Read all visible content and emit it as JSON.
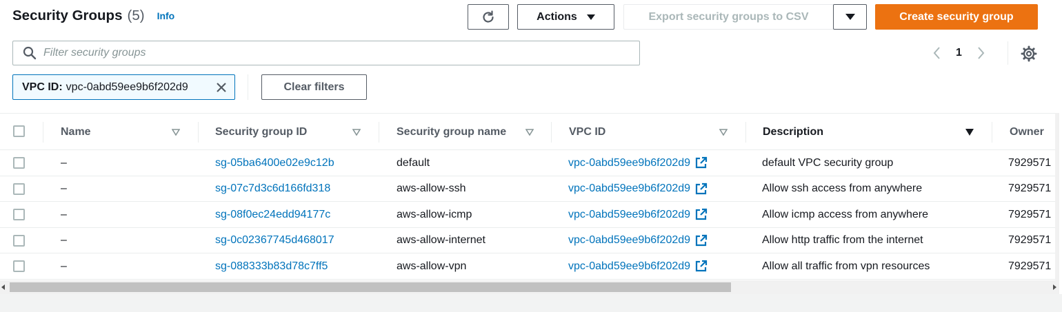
{
  "header": {
    "title": "Security Groups",
    "count": "(5)",
    "info": "Info"
  },
  "toolbar": {
    "refresh_icon": "refresh-icon",
    "actions_label": "Actions",
    "export_label": "Export security groups to CSV",
    "create_label": "Create security group"
  },
  "search": {
    "placeholder": "Filter security groups",
    "value": ""
  },
  "pagination": {
    "page": "1"
  },
  "filters": {
    "token_key": "VPC ID:",
    "token_value": "vpc-0abd59ee9b6f202d9",
    "clear_label": "Clear filters"
  },
  "table": {
    "columns": [
      "Name",
      "Security group ID",
      "Security group name",
      "VPC ID",
      "Description",
      "Owner"
    ],
    "rows": [
      {
        "name": "–",
        "sg_id": "sg-05ba6400e02e9c12b",
        "sg_name": "default",
        "vpc_id": "vpc-0abd59ee9b6f202d9",
        "description": "default VPC security group",
        "owner": "7929571"
      },
      {
        "name": "–",
        "sg_id": "sg-07c7d3c6d166fd318",
        "sg_name": "aws-allow-ssh",
        "vpc_id": "vpc-0abd59ee9b6f202d9",
        "description": "Allow ssh access from anywhere",
        "owner": "7929571"
      },
      {
        "name": "–",
        "sg_id": "sg-08f0ec24edd94177c",
        "sg_name": "aws-allow-icmp",
        "vpc_id": "vpc-0abd59ee9b6f202d9",
        "description": "Allow icmp access from anywhere",
        "owner": "7929571"
      },
      {
        "name": "–",
        "sg_id": "sg-0c02367745d468017",
        "sg_name": "aws-allow-internet",
        "vpc_id": "vpc-0abd59ee9b6f202d9",
        "description": "Allow http traffic from the internet",
        "owner": "7929571"
      },
      {
        "name": "–",
        "sg_id": "sg-088333b83d78c7ff5",
        "sg_name": "aws-allow-vpn",
        "vpc_id": "vpc-0abd59ee9b6f202d9",
        "description": "Allow all traffic from vpn resources",
        "owner": "7929571"
      }
    ]
  },
  "colors": {
    "primary": "#ec7211",
    "link": "#0073bb",
    "text": "#16191f",
    "muted": "#545b64"
  }
}
